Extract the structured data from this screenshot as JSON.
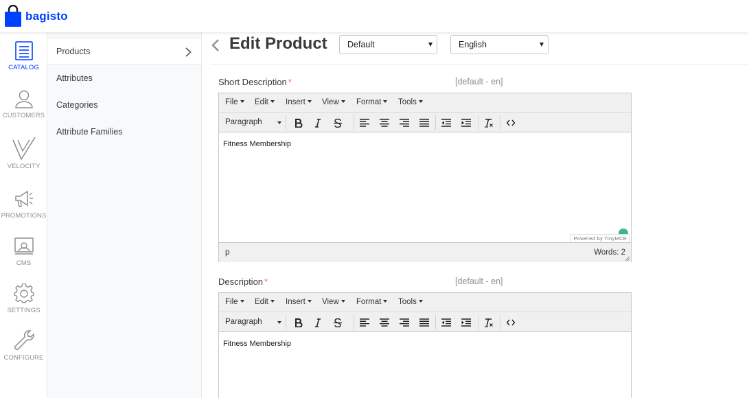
{
  "brand": {
    "name": "bagisto",
    "color": "#0041ff"
  },
  "nav": [
    {
      "label": "CATALOG",
      "icon": "catalog-icon",
      "active": true
    },
    {
      "label": "CUSTOMERS",
      "icon": "customers-icon"
    },
    {
      "label": "VELOCITY",
      "icon": "velocity-icon"
    },
    {
      "label": "PROMOTIONS",
      "icon": "promotions-icon"
    },
    {
      "label": "CMS",
      "icon": "cms-icon"
    },
    {
      "label": "SETTINGS",
      "icon": "settings-icon"
    },
    {
      "label": "CONFIGURE",
      "icon": "configure-icon"
    }
  ],
  "subnav": [
    {
      "label": "Products",
      "active": true
    },
    {
      "label": "Attributes"
    },
    {
      "label": "Categories"
    },
    {
      "label": "Attribute Families"
    }
  ],
  "page": {
    "title": "Edit Product",
    "channel_select": "Default",
    "locale_select": "English"
  },
  "editor_menus": [
    "File",
    "Edit",
    "Insert",
    "View",
    "Format",
    "Tools"
  ],
  "block_format": "Paragraph",
  "fields": [
    {
      "label": "Short Description",
      "locale": "[default - en]",
      "content": "Fitness Membership",
      "status_path": "p",
      "word_count": "Words: 2",
      "powered_by": "Powered by TinyMCE"
    },
    {
      "label": "Description",
      "locale": "[default - en]",
      "content": "Fitness Membership"
    }
  ],
  "required_mark": "*"
}
